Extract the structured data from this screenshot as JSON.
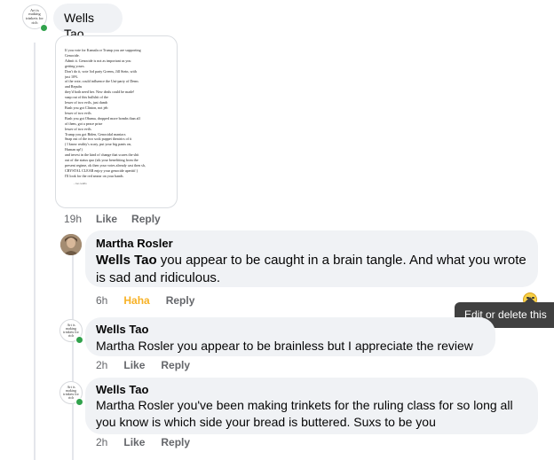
{
  "post": {
    "author": "Wells Tao",
    "avatar_text": "Art is making trinkets for rich"
  },
  "poem_image": {
    "lines": [
      "If you vote for Kamala or Trump you are supporting",
      "Genocide.",
      "Admit it. Genocide is not as important as you",
      "getting yours.",
      "Don't do it, vote 3rd party Greens, Jill Stein, with",
      "just 10%",
      "of the vote, could influence the Uni-party of Dems",
      "and Repubs",
      "they'd both need her. New deals could be made!",
      "snap out of this bullshit of the",
      "lesser of two evils, just dumb",
      "Bush you got Clinton, not jeb",
      "lesser of two evils",
      "Bush you got Obama, dropped more bombs than all",
      "of them, got a peace prize",
      "lesser of two evils",
      "Trump you got Biden, Genocidal maniacs",
      "Snap out of the two sock puppet theatrics of it",
      "( I know reality's scary, put your big pants on,",
      "Human up!)",
      "and invest in the kind of change that scares the shit",
      "out of the status quo (sik your benefitting from the",
      "present regime, ok then your votes already cast then sh,",
      "CRYSTAL CLEAR enjoy your genocide aperitif )",
      "I'll look for the red smear on your hands"
    ],
    "signature": "- tao wells"
  },
  "post_meta": {
    "time": "19h",
    "like": "Like",
    "reply": "Reply"
  },
  "replies": [
    {
      "author": "Martha Rosler",
      "mention": "Wells Tao",
      "text": " you appear to be caught in a brain tangle. And what you wrote is sad and ridiculous.",
      "time": "6h",
      "reaction": "Haha",
      "reply": "Reply"
    },
    {
      "author": "Wells Tao",
      "text": "Martha Rosler you appear to be brainless but I appreciate the review",
      "time": "2h",
      "like": "Like",
      "reply": "Reply"
    },
    {
      "author": "Wells Tao",
      "text": "Martha Rosler you've been making trinkets for the ruling class for so long all you know is which side your bread is buttered. Suxs to be you",
      "time": "2h",
      "like": "Like",
      "reply": "Reply"
    }
  ],
  "tooltip": {
    "text": "Edit or delete this"
  },
  "icons": {
    "reaction_emoji": "laughing-emoji-icon",
    "online": "online-status-dot"
  },
  "colors": {
    "bubble": "#f0f2f5",
    "meta": "#65676b",
    "haha": "#f7b125",
    "online": "#31a24c"
  }
}
